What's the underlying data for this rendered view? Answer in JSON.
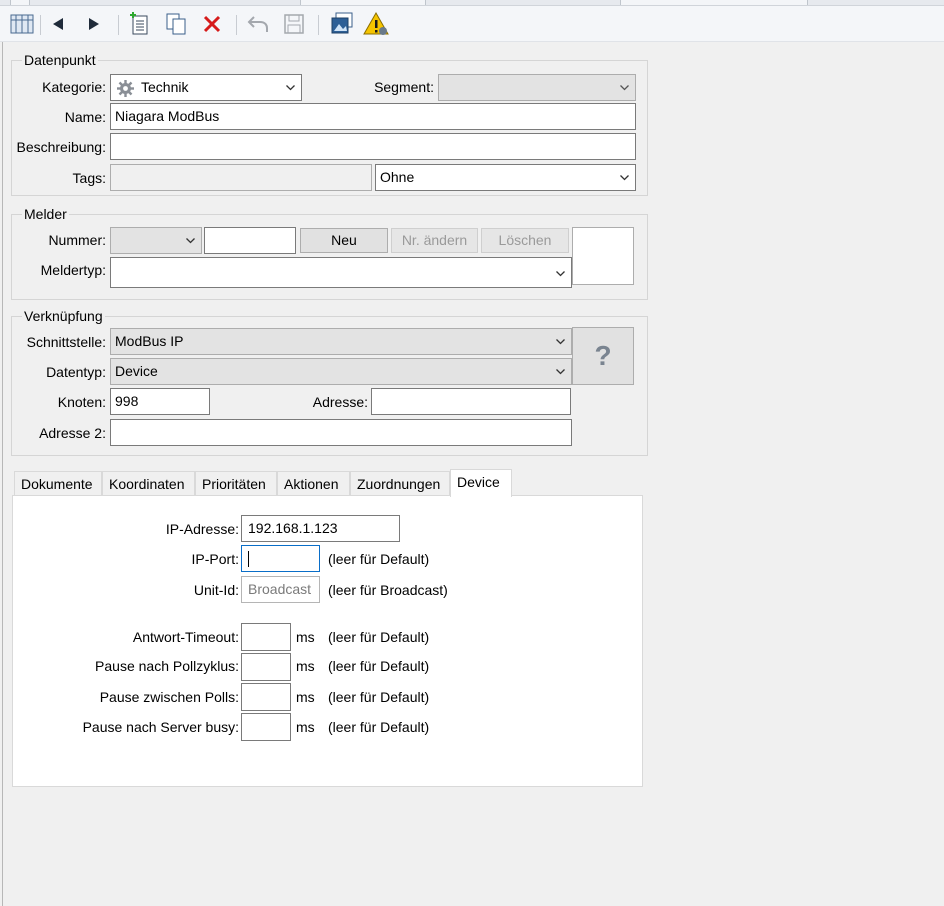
{
  "colors": {
    "accent": "#0a6ec8",
    "delete_red": "#d61b1b",
    "warning_yellow": "#f5c400"
  },
  "toolbar": {
    "icons": [
      "list-view-icon",
      "back-arrow-icon",
      "forward-arrow-icon",
      "new-document-icon",
      "copy-icon",
      "delete-icon",
      "undo-icon",
      "save-icon",
      "image-window-icon",
      "alarm-warning-icon"
    ]
  },
  "datenpunkt": {
    "title": "Datenpunkt",
    "kategorie_label": "Kategorie:",
    "kategorie_value": "Technik",
    "segment_label": "Segment:",
    "segment_value": "",
    "name_label": "Name:",
    "name_value": "Niagara ModBus",
    "beschreibung_label": "Beschreibung:",
    "beschreibung_value": "",
    "tags_label": "Tags:",
    "tags_value": "",
    "tags_select": "Ohne"
  },
  "melder": {
    "title": "Melder",
    "nummer_label": "Nummer:",
    "nummer_select": "",
    "nummer_value": "",
    "neu_label": "Neu",
    "nr_aendern_label": "Nr. ändern",
    "loeschen_label": "Löschen",
    "meldertyp_label": "Meldertyp:",
    "meldertyp_value": ""
  },
  "verknuepfung": {
    "title": "Verknüpfung",
    "schnittstelle_label": "Schnittstelle:",
    "schnittstelle_value": "ModBus IP",
    "datentyp_label": "Datentyp:",
    "datentyp_value": "Device",
    "knoten_label": "Knoten:",
    "knoten_value": "998",
    "adresse_label": "Adresse:",
    "adresse_value": "",
    "adresse2_label": "Adresse 2:",
    "adresse2_value": "",
    "help_glyph": "?"
  },
  "tabs": [
    "Dokumente",
    "Koordinaten",
    "Prioritäten",
    "Aktionen",
    "Zuordnungen",
    "Device"
  ],
  "active_tab": "Device",
  "device": {
    "ip_label": "IP-Adresse:",
    "ip_value": "192.168.1.123",
    "port_label": "IP-Port:",
    "port_value": "",
    "port_hint": "(leer für Default)",
    "unit_label": "Unit-Id:",
    "unit_placeholder": "Broadcast",
    "unit_hint": "(leer für Broadcast)",
    "ms_unit": "ms",
    "default_hint": "(leer für Default)",
    "timing": [
      {
        "label": "Antwort-Timeout:",
        "value": ""
      },
      {
        "label": "Pause nach Pollzyklus:",
        "value": ""
      },
      {
        "label": "Pause zwischen Polls:",
        "value": ""
      },
      {
        "label": "Pause nach Server busy:",
        "value": ""
      }
    ]
  }
}
